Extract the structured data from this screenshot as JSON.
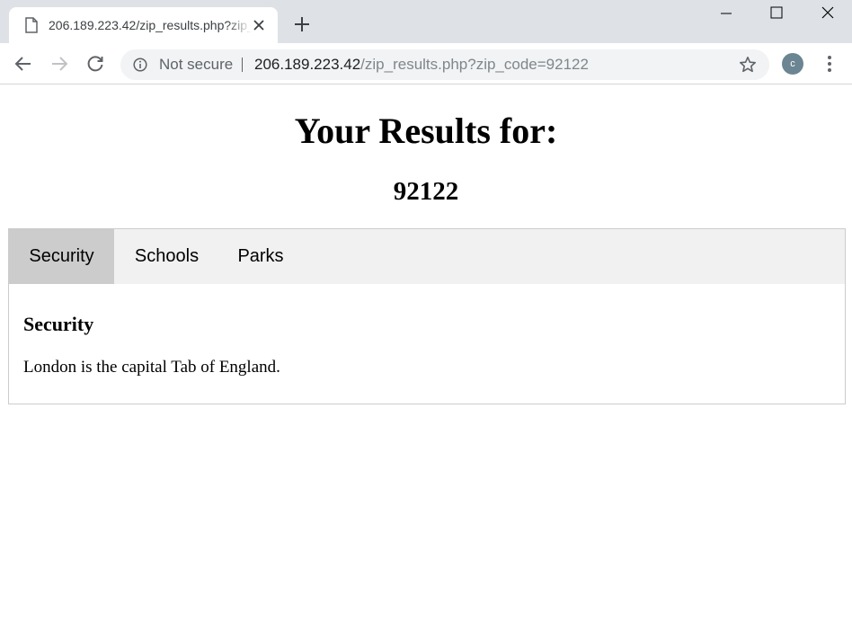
{
  "browser": {
    "tab_title": "206.189.223.42/zip_results.php?zip_code=92122",
    "security_label": "Not secure",
    "url_host": "206.189.223.42",
    "url_path": "/zip_results.php?zip_code=92122",
    "avatar_letter": "c",
    "icons": [
      "page-icon",
      "close-icon",
      "plus-icon",
      "minimize-icon",
      "maximize-icon",
      "window-close-icon",
      "back-icon",
      "forward-icon",
      "reload-icon",
      "info-icon",
      "star-icon",
      "menu-icon"
    ]
  },
  "page": {
    "title": "Your Results for:",
    "zip_code": "92122",
    "tabs": [
      {
        "label": "Security",
        "active": true
      },
      {
        "label": "Schools",
        "active": false
      },
      {
        "label": "Parks",
        "active": false
      }
    ],
    "panel": {
      "heading": "Security",
      "text": "London is the capital Tab of England."
    }
  },
  "colors": {
    "chrome_bg": "#dee1e6",
    "omnibox_bg": "#f1f3f4",
    "tabbar_bg": "#f1f1f1",
    "active_tab_bg": "#cccccc",
    "avatar_bg": "#6b8592"
  }
}
